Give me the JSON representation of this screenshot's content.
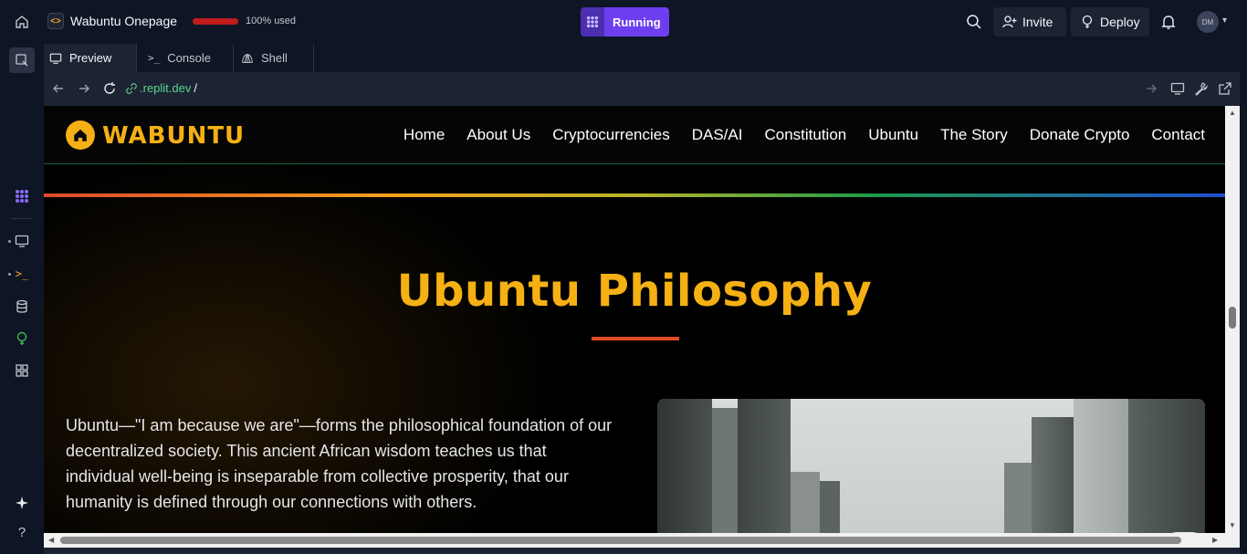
{
  "app": {
    "repl_name": "Wabuntu Onepage",
    "usage_text": "100% used",
    "usage_fraction": 1.0,
    "run_label": "Running",
    "invite_label": "Invite",
    "deploy_label": "Deploy",
    "avatar_initials": "DM"
  },
  "tabs": [
    {
      "label": "Preview",
      "icon": "monitor-icon",
      "active": true
    },
    {
      "label": "Console",
      "icon": "terminal-icon",
      "active": false
    },
    {
      "label": "Shell",
      "icon": "shell-icon",
      "active": false
    }
  ],
  "url": {
    "host": ".replit.dev",
    "path": "/"
  },
  "site": {
    "logo_text": "WABUNTU",
    "nav": [
      "Home",
      "About Us",
      "Cryptocurrencies",
      "DAS/AI",
      "Constitution",
      "Ubuntu",
      "The Story",
      "Donate Crypto",
      "Contact"
    ],
    "section_title": "Ubuntu Philosophy",
    "paragraph": "Ubuntu—\"I am because we are\"—forms the philosophical foundation of our decentralized society. This ancient African wisdom teaches us that individual well-being is inseparable from collective prosperity, that our humanity is defined through our connections with others."
  },
  "colors": {
    "accent": "#f5b014",
    "run": "#6d3ef0",
    "usage": "#c01c1c"
  }
}
